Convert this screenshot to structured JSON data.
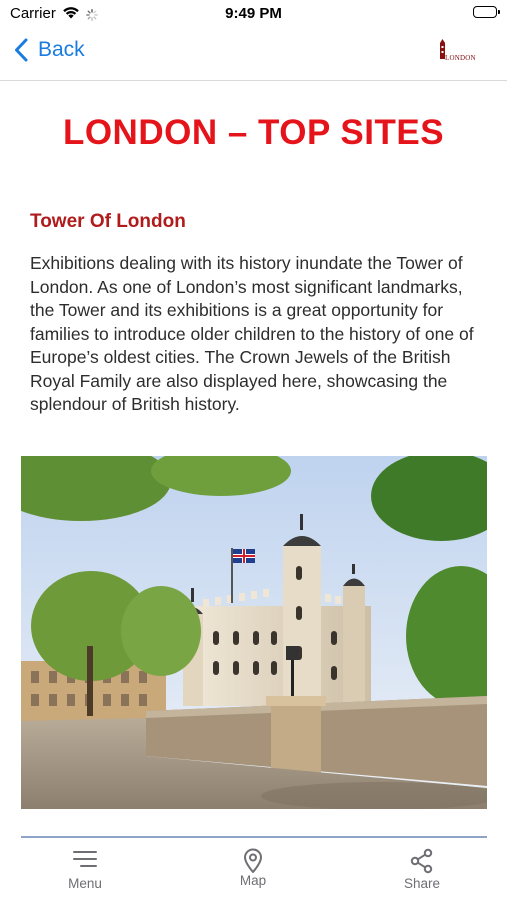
{
  "status_bar": {
    "carrier": "Carrier",
    "time": "9:49 PM"
  },
  "nav": {
    "back_label": "Back",
    "logo_text": "LONDON"
  },
  "page": {
    "title": "LONDON – TOP SITES",
    "section_title": "Tower Of London",
    "description": "Exhibitions dealing with its history inundate the Tower of London. As one of London’s most significant landmarks, the Tower and its exhibitions is a great opportunity for families to introduce older children to the history of one of Europe’s oldest cities. The Crown Jewels of the British Royal Family are also displayed here, showcasing the splendour of British history."
  },
  "tabs": [
    {
      "label": "Menu",
      "icon": "menu-icon"
    },
    {
      "label": "Map",
      "icon": "map-pin-icon"
    },
    {
      "label": "Share",
      "icon": "share-icon"
    }
  ],
  "colors": {
    "accent": "#1a7ce0",
    "title": "#e5141a",
    "section_title": "#b01c1c"
  }
}
